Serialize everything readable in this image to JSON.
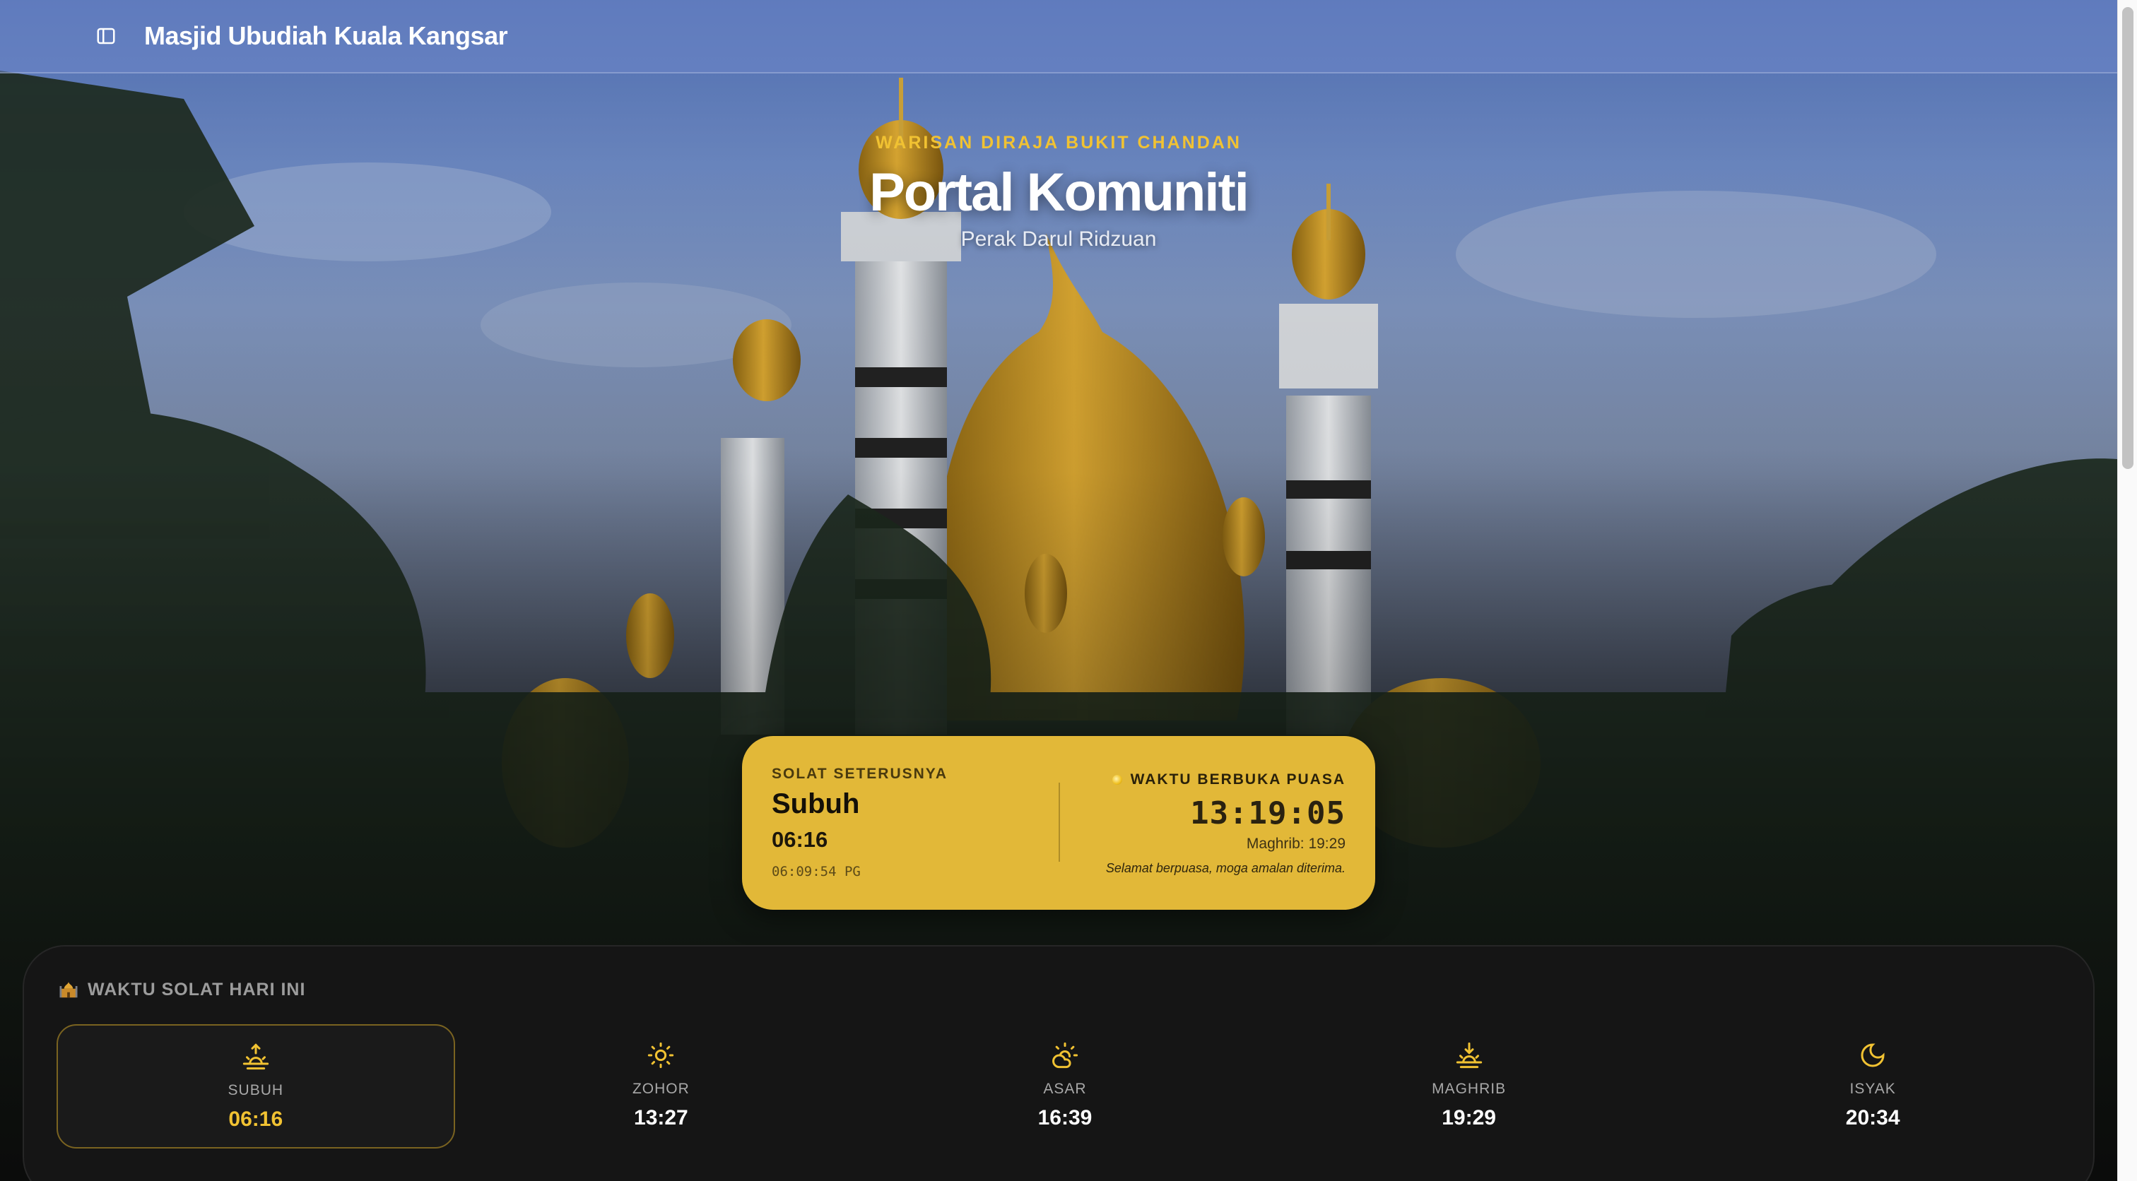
{
  "header": {
    "site_title": "Masjid Ubudiah Kuala Kangsar"
  },
  "hero": {
    "eyebrow": "WARISAN DIRAJA BUKIT CHANDAN",
    "title": "Portal Komuniti",
    "subtitle": "Perak Darul Ridzuan"
  },
  "next_prayer": {
    "label": "SOLAT SETERUSNYA",
    "name": "Subuh",
    "time": "06:16",
    "current_clock": "06:09:54 PG",
    "iftar_label": "WAKTU BERBUKA PUASA",
    "countdown": "13:19:05",
    "maghrib_note": "Maghrib: 19:29",
    "message": "Selamat berpuasa, moga amalan diterima."
  },
  "prayer_times": {
    "title": "WAKTU SOLAT HARI INI",
    "items": [
      {
        "name": "SUBUH",
        "time": "06:16",
        "icon": "sunrise-icon",
        "active": true
      },
      {
        "name": "ZOHOR",
        "time": "13:27",
        "icon": "sun-icon",
        "active": false
      },
      {
        "name": "ASAR",
        "time": "16:39",
        "icon": "cloud-sun-icon",
        "active": false
      },
      {
        "name": "MAGHRIB",
        "time": "19:29",
        "icon": "sunset-icon",
        "active": false
      },
      {
        "name": "ISYAK",
        "time": "20:34",
        "icon": "moon-icon",
        "active": false
      }
    ]
  },
  "colors": {
    "accent_gold": "#f1c232",
    "card_gold": "#e2b838",
    "panel_bg": "#151515"
  }
}
